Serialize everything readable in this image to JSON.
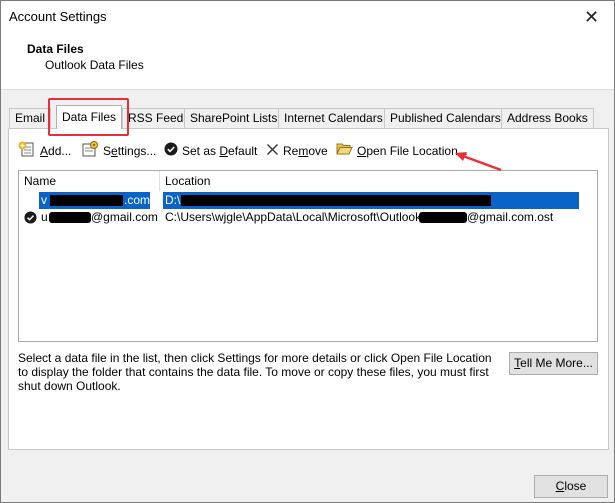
{
  "window": {
    "title": "Account Settings",
    "close_glyph": "✕"
  },
  "header": {
    "title": "Data Files",
    "subtitle": "Outlook Data Files"
  },
  "tabs": [
    {
      "label": "Email"
    },
    {
      "label": "Data Files",
      "active": true
    },
    {
      "label": "RSS Feeds"
    },
    {
      "label": "SharePoint Lists"
    },
    {
      "label": "Internet Calendars"
    },
    {
      "label": "Published Calendars"
    },
    {
      "label": "Address Books"
    }
  ],
  "toolbar": {
    "add": {
      "pre": "",
      "mnemonic": "A",
      "post": "dd...",
      "icon": "add-data-file-icon"
    },
    "settings": {
      "pre": "S",
      "mnemonic": "e",
      "post": "ttings...",
      "icon": "settings-icon"
    },
    "set_default": {
      "pre": "Set as ",
      "mnemonic": "D",
      "post": "efault",
      "icon": "checkmark-circle-icon"
    },
    "remove": {
      "pre": "Re",
      "mnemonic": "m",
      "post": "ove",
      "icon": "close-x-icon"
    },
    "open_location": {
      "pre": "",
      "mnemonic": "O",
      "post": "pen File Location...",
      "icon": "folder-open-icon"
    }
  },
  "list": {
    "columns": {
      "name": "Name",
      "location": "Location"
    },
    "rows": [
      {
        "name_prefix": "v",
        "name_suffix": ".com",
        "location": "D:\\",
        "selected": true,
        "default": false
      },
      {
        "name_prefix": "u",
        "name_suffix": "@gmail.com",
        "location_prefix": "C:\\Users\\wjgle\\AppData\\Local\\Microsoft\\Outlook\\",
        "location_suffix": "@gmail.com.ost",
        "selected": false,
        "default": true
      }
    ]
  },
  "hint": "Select a data file in the list, then click Settings for more details or click Open File Location to display the folder that contains the data file. To move or copy these files, you must first shut down Outlook.",
  "buttons": {
    "tell_me": {
      "mnemonic": "T",
      "rest": "ell Me More..."
    },
    "close": {
      "mnemonic": "C",
      "rest": "lose"
    }
  },
  "colors": {
    "selection": "#0a64c8",
    "highlight_annotation": "#e5303a",
    "arrow": "#e5303a"
  }
}
